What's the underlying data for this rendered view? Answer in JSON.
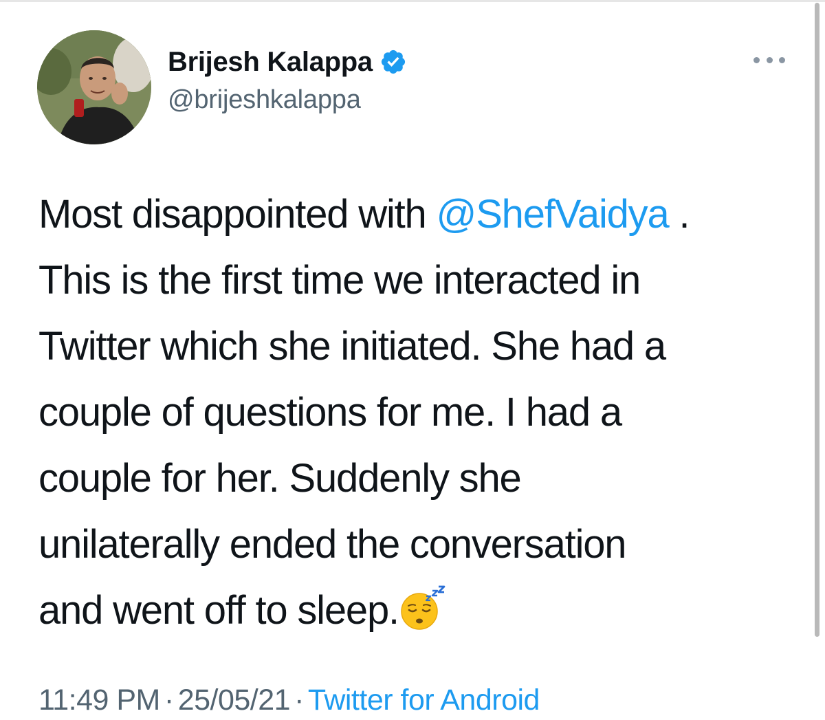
{
  "author": {
    "display_name": "Brijesh Kalappa",
    "handle": "@brijeshkalappa",
    "verified": true
  },
  "tweet": {
    "lines": [
      {
        "before": "Most disappointed with ",
        "mention": "@ShefVaidya",
        "after": " ."
      },
      {
        "text": "This is the first time we interacted in"
      },
      {
        "text": "Twitter which she initiated. She had a"
      },
      {
        "text": "couple of questions for me. I had a"
      },
      {
        "text": "couple for her. Suddenly she"
      },
      {
        "text": "unilaterally ended the conversation"
      },
      {
        "text": "and went off to sleep."
      }
    ],
    "trailing_emoji": "sleeping-face-emoji"
  },
  "meta": {
    "time": "11:49 PM",
    "separator": "·",
    "date": "25/05/21",
    "source": "Twitter for Android"
  },
  "icons": {
    "verified": "verified-badge-icon",
    "more": "more-options-icon"
  },
  "colors": {
    "link": "#1d9bf0",
    "secondary_text": "#536471",
    "primary_text": "#0f1419"
  }
}
